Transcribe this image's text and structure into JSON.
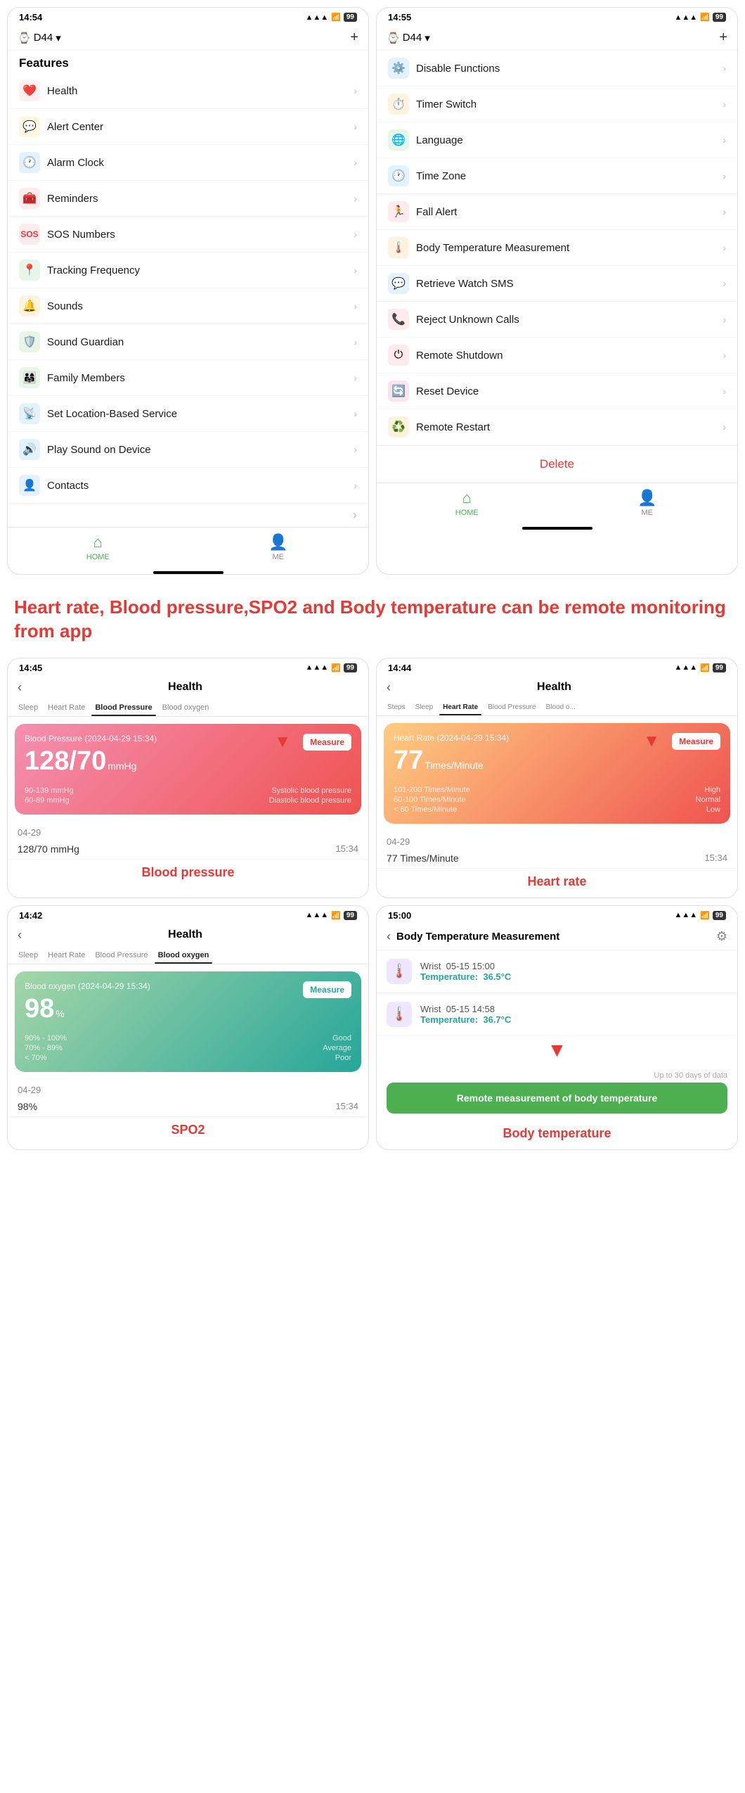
{
  "phone1": {
    "time": "14:54",
    "signal": "▲▲▲",
    "wifi": "WiFi",
    "battery": "99",
    "device": "D44",
    "features_label": "Features",
    "menu": [
      {
        "icon": "❤️",
        "icon_bg": "#fff0f0",
        "label": "Health"
      },
      {
        "icon": "💬",
        "icon_bg": "#fff8e1",
        "label": "Alert Center"
      },
      {
        "icon": "🕐",
        "icon_bg": "#e3f2fd",
        "label": "Alarm Clock"
      },
      {
        "icon": "🧰",
        "icon_bg": "#ffebee",
        "label": "Reminders"
      },
      {
        "icon": "🆘",
        "icon_bg": "#ffebee",
        "label": "SOS Numbers"
      },
      {
        "icon": "📍",
        "icon_bg": "#e8f5e9",
        "label": "Tracking Frequency"
      },
      {
        "icon": "🔔",
        "icon_bg": "#fff3e0",
        "label": "Sounds"
      },
      {
        "icon": "🛡️",
        "icon_bg": "#e8f5e9",
        "label": "Sound Guardian"
      },
      {
        "icon": "👨‍👩‍👧",
        "icon_bg": "#e8f5e9",
        "label": "Family Members"
      },
      {
        "icon": "📡",
        "icon_bg": "#e3f2fd",
        "label": "Set Location-Based Service"
      },
      {
        "icon": "🔊",
        "icon_bg": "#e3f2fd",
        "label": "Play Sound on Device"
      },
      {
        "icon": "👤",
        "icon_bg": "#e3f2fd",
        "label": "Contacts"
      }
    ],
    "nav": [
      {
        "label": "HOME",
        "active": true
      },
      {
        "label": "ME",
        "active": false
      }
    ]
  },
  "phone2": {
    "time": "14:55",
    "signal": "▲▲▲",
    "wifi": "WiFi",
    "battery": "99",
    "device": "D44",
    "menu": [
      {
        "icon": "⚙️",
        "icon_bg": "#e3f2fd",
        "label": "Disable Functions"
      },
      {
        "icon": "⏱️",
        "icon_bg": "#fff3e0",
        "label": "Timer Switch"
      },
      {
        "icon": "🌐",
        "icon_bg": "#e8f5e9",
        "label": "Language"
      },
      {
        "icon": "🕐",
        "icon_bg": "#e3f2fd",
        "label": "Time Zone"
      },
      {
        "icon": "🏃",
        "icon_bg": "#ffebee",
        "label": "Fall Alert"
      },
      {
        "icon": "🌡️",
        "icon_bg": "#fff3e0",
        "label": "Body Temperature Measurement"
      },
      {
        "icon": "💬",
        "icon_bg": "#e3f2fd",
        "label": "Retrieve Watch SMS"
      },
      {
        "icon": "📞",
        "icon_bg": "#ffebee",
        "label": "Reject Unknown Calls"
      },
      {
        "icon": "🔴",
        "icon_bg": "#ffebee",
        "label": "Remote Shutdown"
      },
      {
        "icon": "🔄",
        "icon_bg": "#fce4ec",
        "label": "Reset Device"
      },
      {
        "icon": "♻️",
        "icon_bg": "#fff3e0",
        "label": "Remote Restart"
      }
    ],
    "delete_label": "Delete",
    "nav": [
      {
        "label": "HOME",
        "active": true
      },
      {
        "label": "ME",
        "active": false
      }
    ]
  },
  "promo": {
    "text": "Heart rate, Blood pressure,SPO2 and Body temperature can be remote monitoring from app"
  },
  "health_bp": {
    "time": "14:45",
    "back_label": "‹",
    "page_title": "Health",
    "tabs": [
      "Sleep",
      "Heart Rate",
      "Blood Pressure",
      "Blood oxygen"
    ],
    "active_tab": "Blood Pressure",
    "card": {
      "title": "Blood Pressure  (2024-04-29 15:34)",
      "value": "128/70",
      "unit": "mmHg",
      "measure_label": "Measure",
      "ranges": [
        {
          "range": "90-139 mmHg",
          "label": "Systolic blood pressure"
        },
        {
          "range": "60-89 mmHg",
          "label": "Diastolic blood pressure"
        }
      ]
    },
    "record_date": "04-29",
    "records": [
      {
        "value": "128/70 mmHg",
        "time": "15:34"
      }
    ],
    "caption": "Blood pressure"
  },
  "health_hr": {
    "time": "14:44",
    "back_label": "‹",
    "page_title": "Health",
    "tabs": [
      "Steps",
      "Sleep",
      "Heart Rate",
      "Blood Pressure",
      "Blood o..."
    ],
    "active_tab": "Heart Rate",
    "card": {
      "title": "Heart Rate  (2024-04-29 15:34)",
      "value": "77",
      "unit": "Times/Minute",
      "measure_label": "Measure",
      "ranges": [
        {
          "range": "101-200 Times/Minute",
          "label": "High"
        },
        {
          "range": "60-100 Times/Minute",
          "label": "Normal"
        },
        {
          "range": "< 60 Times/Minute",
          "label": "Low"
        }
      ]
    },
    "record_date": "04-29",
    "records": [
      {
        "value": "77 Times/Minute",
        "time": "15:34"
      }
    ],
    "caption": "Heart rate"
  },
  "health_spo2": {
    "time": "14:42",
    "back_label": "‹",
    "page_title": "Health",
    "tabs": [
      "Sleep",
      "Heart Rate",
      "Blood Pressure",
      "Blood oxygen"
    ],
    "active_tab": "Blood oxygen",
    "card": {
      "title": "Blood oxygen  (2024-04-29 15:34)",
      "value": "98",
      "unit": "%",
      "measure_label": "Measure",
      "ranges": [
        {
          "range": "90% - 100%",
          "label": "Good"
        },
        {
          "range": "70% - 89%",
          "label": "Average"
        },
        {
          "range": "< 70%",
          "label": "Poor"
        }
      ]
    },
    "record_date": "04-29",
    "records": [
      {
        "value": "98%",
        "time": "15:34"
      }
    ],
    "caption": "SPO2"
  },
  "health_temp": {
    "time": "15:00",
    "back_label": "‹",
    "page_title": "Body Temperature Measurement",
    "records": [
      {
        "location": "Wrist",
        "datetime": "05-15 15:00",
        "temp_label": "Temperature:",
        "temp_value": "36.5°C"
      },
      {
        "location": "Wrist",
        "datetime": "05-15 14:58",
        "temp_label": "Temperature:",
        "temp_value": "36.7°C"
      }
    ],
    "hint": "Up to 30 days of data",
    "remote_btn_label": "Remote measurement of body temperature",
    "caption": "Body temperature"
  },
  "icons": {
    "chevron": "›",
    "back": "‹",
    "home": "⌂",
    "person": "👤",
    "plus": "+",
    "gear": "⚙",
    "check": "✓",
    "arrow_down": "▼",
    "location": "📍"
  }
}
